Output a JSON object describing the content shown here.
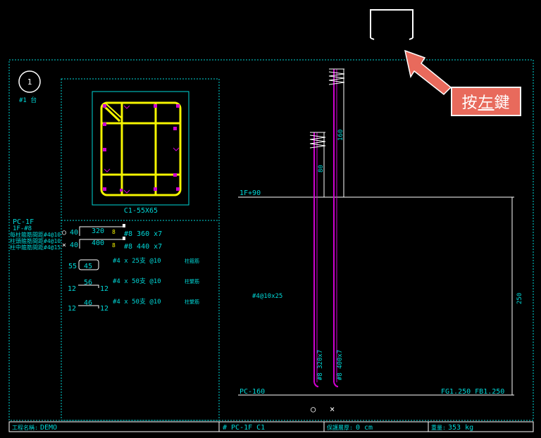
{
  "callout": {
    "prefix": "按",
    "underlined": "左",
    "suffix": "鍵"
  },
  "marker": {
    "number": "1",
    "label": "#1 台"
  },
  "section": {
    "name": "C1-55X65"
  },
  "left_notes": {
    "line1": "PC-1F",
    "line2": "1F-#8",
    "line3": "每柱箍筋間距#4@10",
    "line4": "柱頭箍筋間距#4@10",
    "line5": "柱中箍筋間距#4@15"
  },
  "rebar_rows": [
    {
      "symbol": "○",
      "lead": "40",
      "box": "320",
      "small": "8",
      "spec": "#8  360 x7"
    },
    {
      "symbol": "×",
      "lead": "40",
      "box": "400",
      "small": "8",
      "spec": "#8  440 x7"
    }
  ],
  "stirrups": [
    {
      "lead": "55",
      "value": "45",
      "spec": "#4 x 25支 @10",
      "note": "柱箍筋"
    },
    {
      "left": "12",
      "value": "56",
      "right": "12",
      "spec": "#4 x 50支 @10",
      "note": "柱繫筋"
    },
    {
      "left": "12",
      "value": "46",
      "right": "12",
      "spec": "#4 x 50支 @10",
      "note": "柱繫筋"
    }
  ],
  "elevation": {
    "floor_top": "1F+90",
    "dim_160": "160",
    "dim_80": "80",
    "stirrup_spec": "#4@10x25",
    "bar1": "#8 320x7",
    "bar2": "#8 400x7",
    "dim_250": "250",
    "pc_level": "PC-160",
    "fg_level": "FG1.250 FB1.250",
    "legend_circle": "○",
    "legend_cross": "×"
  },
  "footer": {
    "project_label": "工程名稱:",
    "project_value": "DEMO",
    "member_value": "# PC-1F C1",
    "cover_label": "保護層厚:",
    "cover_value": "0 cm",
    "weight_label": "重量:",
    "weight_value": "353 kg"
  },
  "colors": {
    "cyan": "#00d8d8",
    "yellow": "#f5f500",
    "magenta": "#d000d0",
    "white": "#ffffff",
    "callout": "#e86a5c"
  }
}
